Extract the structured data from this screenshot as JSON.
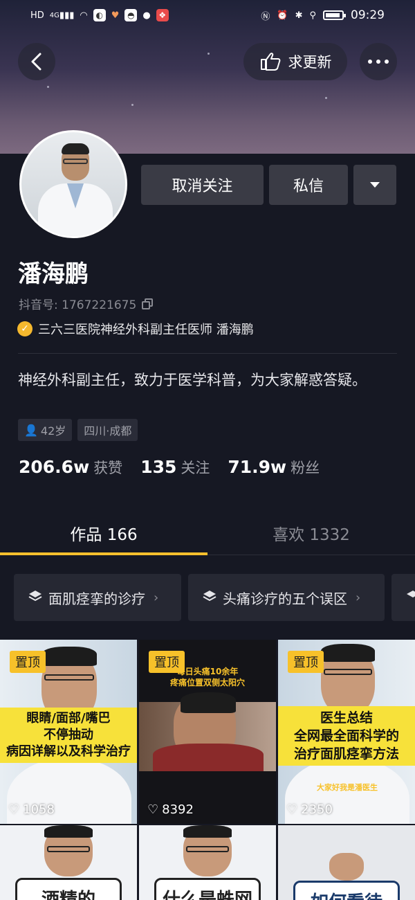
{
  "status_bar": {
    "left_icons": [
      "hd-icon",
      "4g-signal-icon",
      "wifi-icon",
      "app-icon",
      "heart-app-icon",
      "app-icon-2",
      "chat-icon",
      "gift-icon"
    ],
    "hd": "HD",
    "network": "4G",
    "right_icons": [
      "nfc-icon",
      "alarm-icon",
      "bluetooth-icon",
      "location-icon",
      "battery-icon"
    ],
    "time": "09:29"
  },
  "header": {
    "update_label": "求更新"
  },
  "profile": {
    "name": "潘海鹏",
    "douyin_id": "抖音号: 1767221675",
    "verified_text": "三六三医院神经外科副主任医师 潘海鹏",
    "bio": "神经外科副主任，致力于医学科普，为大家解惑答疑。",
    "tags": [
      "42岁",
      "四川·成都"
    ],
    "stats": [
      {
        "num": "206.6w",
        "label": "获赞"
      },
      {
        "num": "135",
        "label": "关注"
      },
      {
        "num": "71.9w",
        "label": "粉丝"
      }
    ]
  },
  "actions": {
    "unfollow": "取消关注",
    "message": "私信"
  },
  "tabs": {
    "works": "作品 166",
    "likes": "喜欢 1332"
  },
  "collections": [
    {
      "label": "面肌痉挛的诊疗"
    },
    {
      "label": "头痛诊疗的五个误区"
    }
  ],
  "videos": [
    {
      "pinned": "置顶",
      "likes": "1058",
      "caption": [
        "眼睛/面部/嘴巴",
        "不停抽动",
        "病因详解以及科学治疗"
      ]
    },
    {
      "pinned": "置顶",
      "likes": "8392",
      "caption": [
        "每日头痛10余年",
        "疼痛位置双侧太阳穴"
      ]
    },
    {
      "pinned": "置顶",
      "likes": "2350",
      "caption": [
        "医生总结",
        "全网最全面科学的",
        "治疗面肌痉挛方法"
      ],
      "subcaption": "大家好我是潘医生"
    },
    {
      "title": "酒精的"
    },
    {
      "title": "什么是蛛网"
    },
    {
      "title": "如何看待"
    }
  ],
  "colors": {
    "background": "#161823",
    "accent": "#fbc02d",
    "button_bg": "#3a3b45"
  }
}
